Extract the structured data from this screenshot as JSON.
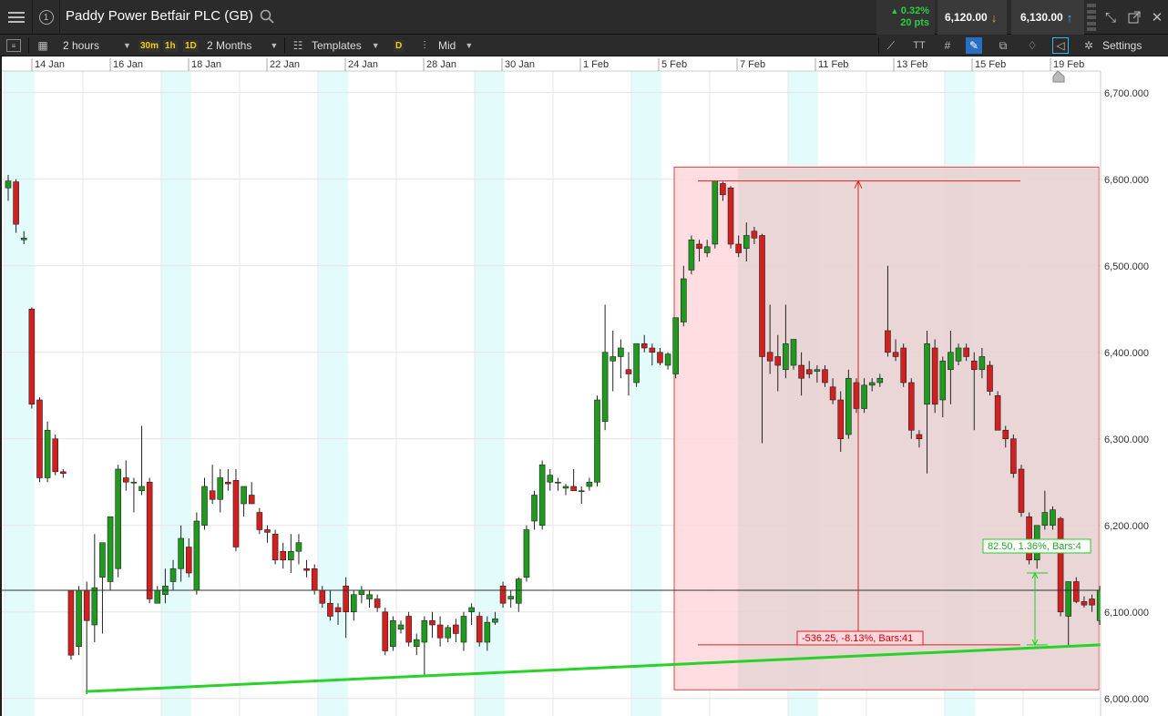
{
  "header": {
    "instrument_name": "Paddy Power Betfair PLC (GB)",
    "change_pct": "0.32%",
    "change_pts": "20 pts",
    "sell_price": "6,120.00",
    "buy_price": "6,130.00"
  },
  "toolbar": {
    "interval": "2 hours",
    "quick_intervals": [
      "30m",
      "1h",
      "1D"
    ],
    "range": "2 Months",
    "templates_label": "Templates",
    "d_label": "D",
    "price_type": "Mid",
    "settings_label": "Settings"
  },
  "icons": [
    "menu-icon",
    "info-icon",
    "search-icon",
    "collapse-icon",
    "popout-icon",
    "panel-icon",
    "chart-type-icon",
    "templates-icon",
    "candles-icon",
    "line-tool-icon",
    "text-tool-icon",
    "grid-icon",
    "crosshair-icon",
    "layers-icon",
    "indicator-icon",
    "measure-icon",
    "settings-icon"
  ],
  "colors": {
    "up_candle": "#1f9a1f",
    "down_candle": "#d21f1f",
    "trendline": "#28d228",
    "measure_box": "#ffd7dc",
    "current_price_label": "#c0141e",
    "weekend_band": "#e4fbfc"
  },
  "chart_data": {
    "type": "candlestick",
    "interval": "2 hours",
    "x_labels": [
      "14 Jan",
      "16 Jan",
      "18 Jan",
      "22 Jan",
      "24 Jan",
      "28 Jan",
      "30 Jan",
      "1 Feb",
      "5 Feb",
      "7 Feb",
      "11 Feb",
      "13 Feb",
      "15 Feb",
      "19 Feb"
    ],
    "y_ticks": [
      "6,700.000",
      "6,600.000",
      "6,500.000",
      "6,400.000",
      "6,300.000",
      "6,200.000",
      "6,100.000",
      "6,000.000"
    ],
    "ylim": [
      5985,
      6725
    ],
    "current_price": "6,125.000",
    "candles": [
      {
        "o": 6590,
        "h": 6605,
        "l": 6575,
        "c": 6598
      },
      {
        "o": 6597,
        "h": 6600,
        "l": 6538,
        "c": 6548
      },
      {
        "o": 6530,
        "h": 6540,
        "l": 6525,
        "c": 6532
      },
      {
        "o": 6450,
        "h": 6452,
        "l": 6335,
        "c": 6340
      },
      {
        "o": 6345,
        "h": 6348,
        "l": 6250,
        "c": 6255
      },
      {
        "o": 6255,
        "h": 6320,
        "l": 6250,
        "c": 6310
      },
      {
        "o": 6300,
        "h": 6305,
        "l": 6258,
        "c": 6262
      },
      {
        "o": 6262,
        "h": 6265,
        "l": 6255,
        "c": 6260
      },
      {
        "o": 6125,
        "h": 6125,
        "l": 6045,
        "c": 6050
      },
      {
        "o": 6060,
        "h": 6130,
        "l": 6050,
        "c": 6125
      },
      {
        "o": 6125,
        "h": 6135,
        "l": 6005,
        "c": 6090
      },
      {
        "o": 6085,
        "h": 6190,
        "l": 6065,
        "c": 6128
      },
      {
        "o": 6140,
        "h": 6180,
        "l": 6075,
        "c": 6180
      },
      {
        "o": 6135,
        "h": 6205,
        "l": 6125,
        "c": 6210
      },
      {
        "o": 6150,
        "h": 6270,
        "l": 6140,
        "c": 6265
      },
      {
        "o": 6255,
        "h": 6275,
        "l": 6240,
        "c": 6250
      },
      {
        "o": 6250,
        "h": 6255,
        "l": 6215,
        "c": 6250
      },
      {
        "o": 6240,
        "h": 6315,
        "l": 6235,
        "c": 6245
      },
      {
        "o": 6250,
        "h": 6255,
        "l": 6110,
        "c": 6115
      },
      {
        "o": 6110,
        "h": 6130,
        "l": 6110,
        "c": 6125
      },
      {
        "o": 6120,
        "h": 6150,
        "l": 6110,
        "c": 6130
      },
      {
        "o": 6135,
        "h": 6160,
        "l": 6125,
        "c": 6150
      },
      {
        "o": 6150,
        "h": 6200,
        "l": 6135,
        "c": 6185
      },
      {
        "o": 6175,
        "h": 6185,
        "l": 6140,
        "c": 6145
      },
      {
        "o": 6125,
        "h": 6215,
        "l": 6120,
        "c": 6205
      },
      {
        "o": 6200,
        "h": 6255,
        "l": 6195,
        "c": 6245
      },
      {
        "o": 6240,
        "h": 6270,
        "l": 6225,
        "c": 6230
      },
      {
        "o": 6230,
        "h": 6265,
        "l": 6215,
        "c": 6255
      },
      {
        "o": 6250,
        "h": 6265,
        "l": 6240,
        "c": 6248
      },
      {
        "o": 6252,
        "h": 6265,
        "l": 6170,
        "c": 6175
      },
      {
        "o": 6225,
        "h": 6240,
        "l": 6210,
        "c": 6245
      },
      {
        "o": 6235,
        "h": 6250,
        "l": 6225,
        "c": 6225
      },
      {
        "o": 6215,
        "h": 6220,
        "l": 6190,
        "c": 6195
      },
      {
        "o": 6195,
        "h": 6200,
        "l": 6180,
        "c": 6192
      },
      {
        "o": 6190,
        "h": 6195,
        "l": 6155,
        "c": 6160
      },
      {
        "o": 6170,
        "h": 6180,
        "l": 6150,
        "c": 6160
      },
      {
        "o": 6160,
        "h": 6190,
        "l": 6145,
        "c": 6170
      },
      {
        "o": 6170,
        "h": 6190,
        "l": 6155,
        "c": 6180
      },
      {
        "o": 6150,
        "h": 6160,
        "l": 6140,
        "c": 6148
      },
      {
        "o": 6150,
        "h": 6155,
        "l": 6120,
        "c": 6125
      },
      {
        "o": 6125,
        "h": 6130,
        "l": 6105,
        "c": 6110
      },
      {
        "o": 6110,
        "h": 6125,
        "l": 6090,
        "c": 6095
      },
      {
        "o": 6105,
        "h": 6110,
        "l": 6085,
        "c": 6100
      },
      {
        "o": 6130,
        "h": 6140,
        "l": 6070,
        "c": 6100
      },
      {
        "o": 6100,
        "h": 6125,
        "l": 6090,
        "c": 6120
      },
      {
        "o": 6120,
        "h": 6130,
        "l": 6110,
        "c": 6125
      },
      {
        "o": 6115,
        "h": 6125,
        "l": 6105,
        "c": 6120
      },
      {
        "o": 6115,
        "h": 6120,
        "l": 6100,
        "c": 6105
      },
      {
        "o": 6100,
        "h": 6105,
        "l": 6050,
        "c": 6055
      },
      {
        "o": 6060,
        "h": 6095,
        "l": 6055,
        "c": 6090
      },
      {
        "o": 6080,
        "h": 6090,
        "l": 6075,
        "c": 6085
      },
      {
        "o": 6095,
        "h": 6100,
        "l": 6060,
        "c": 6065
      },
      {
        "o": 6060,
        "h": 6075,
        "l": 6050,
        "c": 6068
      },
      {
        "o": 6065,
        "h": 6095,
        "l": 6025,
        "c": 6090
      },
      {
        "o": 6090,
        "h": 6100,
        "l": 6070,
        "c": 6085
      },
      {
        "o": 6085,
        "h": 6095,
        "l": 6060,
        "c": 6070
      },
      {
        "o": 6070,
        "h": 6085,
        "l": 6065,
        "c": 6082
      },
      {
        "o": 6085,
        "h": 6092,
        "l": 6065,
        "c": 6075
      },
      {
        "o": 6065,
        "h": 6100,
        "l": 6055,
        "c": 6095
      },
      {
        "o": 6100,
        "h": 6110,
        "l": 6085,
        "c": 6105
      },
      {
        "o": 6095,
        "h": 6100,
        "l": 6060,
        "c": 6065
      },
      {
        "o": 6065,
        "h": 6095,
        "l": 6055,
        "c": 6088
      },
      {
        "o": 6088,
        "h": 6100,
        "l": 6085,
        "c": 6092
      },
      {
        "o": 6130,
        "h": 6135,
        "l": 6105,
        "c": 6110
      },
      {
        "o": 6115,
        "h": 6125,
        "l": 6105,
        "c": 6118
      },
      {
        "o": 6110,
        "h": 6140,
        "l": 6100,
        "c": 6138
      },
      {
        "o": 6140,
        "h": 6200,
        "l": 6135,
        "c": 6195
      },
      {
        "o": 6205,
        "h": 6240,
        "l": 6195,
        "c": 6235
      },
      {
        "o": 6200,
        "h": 6275,
        "l": 6195,
        "c": 6270
      },
      {
        "o": 6250,
        "h": 6265,
        "l": 6240,
        "c": 6258
      },
      {
        "o": 6250,
        "h": 6255,
        "l": 6240,
        "c": 6250
      },
      {
        "o": 6243,
        "h": 6248,
        "l": 6235,
        "c": 6245
      },
      {
        "o": 6245,
        "h": 6265,
        "l": 6240,
        "c": 6240
      },
      {
        "o": 6240,
        "h": 6245,
        "l": 6225,
        "c": 6240
      },
      {
        "o": 6245,
        "h": 6255,
        "l": 6240,
        "c": 6250
      },
      {
        "o": 6250,
        "h": 6350,
        "l": 6245,
        "c": 6345
      },
      {
        "o": 6320,
        "h": 6455,
        "l": 6310,
        "c": 6400
      },
      {
        "o": 6390,
        "h": 6425,
        "l": 6355,
        "c": 6395
      },
      {
        "o": 6395,
        "h": 6415,
        "l": 6370,
        "c": 6405
      },
      {
        "o": 6380,
        "h": 6400,
        "l": 6350,
        "c": 6375
      },
      {
        "o": 6365,
        "h": 6410,
        "l": 6360,
        "c": 6410
      },
      {
        "o": 6410,
        "h": 6420,
        "l": 6400,
        "c": 6405
      },
      {
        "o": 6405,
        "h": 6410,
        "l": 6385,
        "c": 6400
      },
      {
        "o": 6400,
        "h": 6405,
        "l": 6385,
        "c": 6388
      },
      {
        "o": 6385,
        "h": 6400,
        "l": 6380,
        "c": 6398
      },
      {
        "o": 6375,
        "h": 6440,
        "l": 6370,
        "c": 6440
      },
      {
        "o": 6435,
        "h": 6500,
        "l": 6430,
        "c": 6485
      },
      {
        "o": 6495,
        "h": 6535,
        "l": 6490,
        "c": 6530
      },
      {
        "o": 6525,
        "h": 6530,
        "l": 6505,
        "c": 6520
      },
      {
        "o": 6515,
        "h": 6530,
        "l": 6510,
        "c": 6522
      },
      {
        "o": 6525,
        "h": 6598,
        "l": 6520,
        "c": 6598
      },
      {
        "o": 6595,
        "h": 6597,
        "l": 6575,
        "c": 6582
      },
      {
        "o": 6590,
        "h": 6592,
        "l": 6520,
        "c": 6525
      },
      {
        "o": 6525,
        "h": 6535,
        "l": 6510,
        "c": 6515
      },
      {
        "o": 6520,
        "h": 6550,
        "l": 6505,
        "c": 6535
      },
      {
        "o": 6540,
        "h": 6545,
        "l": 6525,
        "c": 6532
      },
      {
        "o": 6535,
        "h": 6537,
        "l": 6295,
        "c": 6395
      },
      {
        "o": 6400,
        "h": 6455,
        "l": 6375,
        "c": 6390
      },
      {
        "o": 6395,
        "h": 6420,
        "l": 6355,
        "c": 6385
      },
      {
        "o": 6380,
        "h": 6455,
        "l": 6370,
        "c": 6410
      },
      {
        "o": 6385,
        "h": 6410,
        "l": 6380,
        "c": 6415
      },
      {
        "o": 6385,
        "h": 6400,
        "l": 6350,
        "c": 6370
      },
      {
        "o": 6380,
        "h": 6390,
        "l": 6370,
        "c": 6375
      },
      {
        "o": 6378,
        "h": 6385,
        "l": 6365,
        "c": 6380
      },
      {
        "o": 6380,
        "h": 6385,
        "l": 6360,
        "c": 6365
      },
      {
        "o": 6360,
        "h": 6370,
        "l": 6340,
        "c": 6345
      },
      {
        "o": 6345,
        "h": 6355,
        "l": 6285,
        "c": 6300
      },
      {
        "o": 6305,
        "h": 6380,
        "l": 6300,
        "c": 6370
      },
      {
        "o": 6365,
        "h": 6370,
        "l": 6330,
        "c": 6335
      },
      {
        "o": 6335,
        "h": 6370,
        "l": 6330,
        "c": 6362
      },
      {
        "o": 6362,
        "h": 6370,
        "l": 6355,
        "c": 6365
      },
      {
        "o": 6365,
        "h": 6375,
        "l": 6360,
        "c": 6370
      },
      {
        "o": 6425,
        "h": 6500,
        "l": 6395,
        "c": 6400
      },
      {
        "o": 6400,
        "h": 6415,
        "l": 6390,
        "c": 6395
      },
      {
        "o": 6405,
        "h": 6410,
        "l": 6360,
        "c": 6365
      },
      {
        "o": 6365,
        "h": 6370,
        "l": 6300,
        "c": 6310
      },
      {
        "o": 6305,
        "h": 6310,
        "l": 6290,
        "c": 6300
      },
      {
        "o": 6340,
        "h": 6425,
        "l": 6260,
        "c": 6410
      },
      {
        "o": 6405,
        "h": 6415,
        "l": 6330,
        "c": 6340
      },
      {
        "o": 6345,
        "h": 6395,
        "l": 6325,
        "c": 6390
      },
      {
        "o": 6380,
        "h": 6425,
        "l": 6340,
        "c": 6400
      },
      {
        "o": 6390,
        "h": 6410,
        "l": 6385,
        "c": 6405
      },
      {
        "o": 6405,
        "h": 6410,
        "l": 6390,
        "c": 6395
      },
      {
        "o": 6390,
        "h": 6400,
        "l": 6310,
        "c": 6380
      },
      {
        "o": 6380,
        "h": 6405,
        "l": 6370,
        "c": 6395
      },
      {
        "o": 6385,
        "h": 6390,
        "l": 6350,
        "c": 6355
      },
      {
        "o": 6350,
        "h": 6355,
        "l": 6310,
        "c": 6310
      },
      {
        "o": 6310,
        "h": 6315,
        "l": 6290,
        "c": 6300
      },
      {
        "o": 6300,
        "h": 6305,
        "l": 6255,
        "c": 6260
      },
      {
        "o": 6265,
        "h": 6270,
        "l": 6210,
        "c": 6215
      },
      {
        "o": 6210,
        "h": 6215,
        "l": 6155,
        "c": 6160
      },
      {
        "o": 6160,
        "h": 6200,
        "l": 6150,
        "c": 6200
      },
      {
        "o": 6200,
        "h": 6240,
        "l": 6195,
        "c": 6215
      },
      {
        "o": 6200,
        "h": 6222,
        "l": 6195,
        "c": 6218
      },
      {
        "o": 6208,
        "h": 6210,
        "l": 6095,
        "c": 6100
      },
      {
        "o": 6095,
        "h": 6135,
        "l": 6060,
        "c": 6135
      },
      {
        "o": 6135,
        "h": 6140,
        "l": 6110,
        "c": 6112
      },
      {
        "o": 6112,
        "h": 6118,
        "l": 6105,
        "c": 6108
      },
      {
        "o": 6115,
        "h": 6120,
        "l": 6100,
        "c": 6108
      },
      {
        "o": 6090,
        "h": 6130,
        "l": 6085,
        "c": 6125
      }
    ],
    "trendline": {
      "from": {
        "x": "14 Jan 22:00",
        "y": 6008
      },
      "to": {
        "x": "19 Feb",
        "y": 6062
      }
    },
    "annotations": [
      {
        "type": "price-range",
        "label": "-536.25, -8.13%, Bars:41",
        "high": 6598,
        "low": 6062
      },
      {
        "type": "price-range",
        "label": "82.50, 1.36%, Bars:4",
        "high": 6145,
        "low": 6062
      }
    ]
  }
}
